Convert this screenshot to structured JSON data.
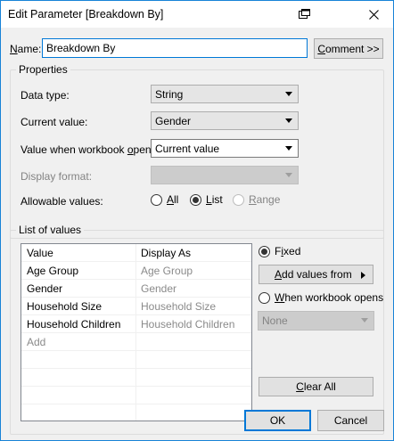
{
  "window": {
    "title": "Edit Parameter [Breakdown By]"
  },
  "name_row": {
    "label_prefix": "N",
    "label_rest": "ame:",
    "value": "Breakdown By",
    "comment_prefix": "C",
    "comment_rest": "omment >>"
  },
  "properties": {
    "title": "Properties",
    "data_type": {
      "label": "Data type:",
      "value": "String"
    },
    "current_value": {
      "label": "Current value:",
      "value": "Gender"
    },
    "when_opens": {
      "label_before": "Value when workbook ",
      "label_u": "o",
      "label_after": "pens:",
      "value": "Current value"
    },
    "display_format": {
      "label": "Display format:",
      "value": ""
    },
    "allowable": {
      "label": "Allowable values:",
      "options": [
        {
          "u": "A",
          "rest": "ll",
          "checked": false,
          "disabled": false
        },
        {
          "u": "L",
          "rest": "ist",
          "checked": true,
          "disabled": false
        },
        {
          "u": "R",
          "rest": "ange",
          "checked": false,
          "disabled": true
        }
      ]
    }
  },
  "list_of_values": {
    "title": "List of values",
    "headers": {
      "value": "Value",
      "display": "Display As"
    },
    "rows": [
      {
        "value": "Age Group",
        "display": "Age Group"
      },
      {
        "value": "Gender",
        "display": "Gender"
      },
      {
        "value": "Household Size",
        "display": "Household Size"
      },
      {
        "value": "Household Children",
        "display": "Household Children"
      }
    ],
    "add_placeholder": "Add",
    "fixed": {
      "u": "i",
      "before": "F",
      "after": "xed",
      "checked": true
    },
    "add_values_from": {
      "u": "A",
      "rest": "dd values from"
    },
    "when_workbook_opens": {
      "u": "W",
      "rest": "hen workbook opens",
      "checked": false
    },
    "none_select": "None",
    "clear_all": {
      "u": "C",
      "rest": "lear All"
    }
  },
  "footer": {
    "ok": "OK",
    "cancel": "Cancel"
  }
}
